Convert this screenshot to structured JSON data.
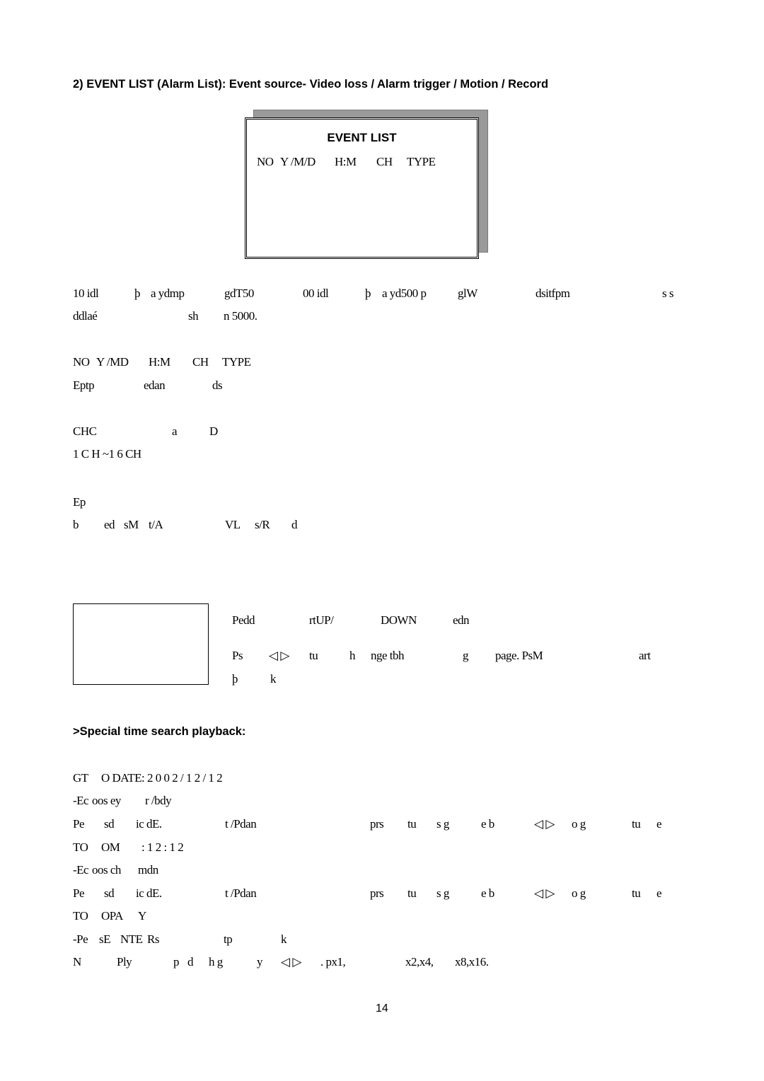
{
  "heading": "2) EVENT LIST (Alarm List): Event source- Video loss / Alarm trigger / Motion / Record",
  "event_box": {
    "title": "EVENT LIST",
    "columns": [
      "NO",
      "Y /M/D",
      "H:M",
      "CH",
      "TYPE"
    ]
  },
  "lines": [
    [
      "10 idl",
      "þ",
      "a ydmp",
      "gdT50",
      "00 idl",
      "þ",
      "a yd500 p",
      "glW",
      "dsitfpm",
      "s s"
    ],
    [
      "ddlaé",
      "sh",
      "n 5000."
    ],
    [
      "NO",
      "Y /MD",
      "H:M",
      "CH",
      "TYPE"
    ],
    [
      "Eptp",
      "edan",
      "ds"
    ],
    [
      "CHC",
      "a",
      "D"
    ],
    [
      "1 C H ~1 6 CH"
    ],
    [
      "Ep"
    ],
    [
      "b",
      "ed",
      "sM",
      "t/A",
      "VL",
      "s/R",
      "d"
    ],
    [
      "Pedd",
      "rtUP/",
      "DOWN",
      "edn"
    ],
    [
      "Ps",
      "◁ ▷",
      "tu",
      "h",
      "nge tbh",
      "g",
      "page. PsM",
      "art"
    ],
    [
      "þ",
      "k"
    ],
    [
      "GT",
      "O DATE",
      ": 2 0 0 2 / 1 2 / 1 2"
    ],
    [
      "-Ec",
      "oos ey",
      "r /bdy"
    ],
    [
      "Pe",
      "sd",
      "ic dE.",
      "t /Pdan",
      "prs",
      "tu",
      "s g",
      "e b",
      "◁ ▷",
      "o g",
      "tu",
      "e"
    ],
    [
      "TO",
      "OM",
      ": 1 2 : 1 2"
    ],
    [
      "-Ec",
      "oos ch",
      "mdn"
    ],
    [
      "Pe",
      "sd",
      "ic dE.",
      "t /Pdan",
      "prs",
      "tu",
      "s g",
      "e b",
      "◁ ▷",
      "o g",
      "tu",
      "e"
    ],
    [
      "TO",
      "OPA",
      "Y"
    ],
    [
      "-Pe",
      "sE",
      "NTE",
      "Rs",
      "tp",
      "k"
    ],
    [
      "N",
      "Ply",
      "p",
      "d",
      "h g",
      "y",
      "◁ ▷",
      ". px1,",
      "x2,x4,",
      "x8,x16."
    ]
  ],
  "subheading": ">Special time search playback:",
  "page_number": "14"
}
